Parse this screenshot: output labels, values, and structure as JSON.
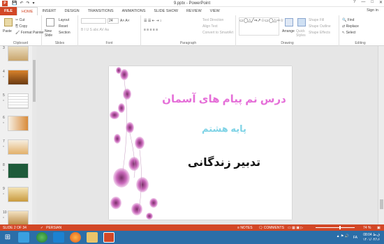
{
  "window": {
    "title": "9.pptx - PowerPoint",
    "app_icon": "P",
    "quick_access": [
      "save-icon",
      "undo-icon",
      "redo-icon",
      "customize-icon"
    ],
    "controls": [
      "?",
      "—",
      "□",
      "✕"
    ]
  },
  "tabs": [
    "FILE",
    "HOME",
    "INSERT",
    "DESIGN",
    "TRANSITIONS",
    "ANIMATIONS",
    "SLIDE SHOW",
    "REVIEW",
    "VIEW"
  ],
  "active_tab": "HOME",
  "signin": "Sign in",
  "ribbon": {
    "clipboard": {
      "label": "Clipboard",
      "paste": "Paste",
      "cut": "Cut",
      "copy": "Copy",
      "format_painter": "Format Painter"
    },
    "slides": {
      "label": "Slides",
      "new_slide": "New Slide",
      "layout": "Layout",
      "reset": "Reset",
      "section": "Section"
    },
    "font": {
      "label": "Font",
      "size": "24",
      "styles": "B  I  U  S  abc  AV  Aa",
      "grow_shrink": "A˄ A˅"
    },
    "paragraph": {
      "label": "Paragraph",
      "text_direction": "Text Direction",
      "align_text": "Align Text",
      "smartart": "Convert to SmartArt"
    },
    "drawing": {
      "label": "Drawing",
      "arrange": "Arrange",
      "quick_styles": "Quick Styles",
      "shape_fill": "Shape Fill",
      "shape_outline": "Shape Outline",
      "shape_effects": "Shape Effects"
    },
    "editing": {
      "label": "Editing",
      "find": "Find",
      "replace": "Replace",
      "select": "Select"
    }
  },
  "thumbnails": [
    {
      "num": "3",
      "star": ""
    },
    {
      "num": "4",
      "star": "*"
    },
    {
      "num": "5",
      "star": "*"
    },
    {
      "num": "6",
      "star": "*"
    },
    {
      "num": "7",
      "star": "*"
    },
    {
      "num": "8",
      "star": "*"
    },
    {
      "num": "9",
      "star": "*"
    },
    {
      "num": "10",
      "star": "*"
    }
  ],
  "slide": {
    "line1": "درس نم پیام های آسمان",
    "line2": "پایه هشتم",
    "line3": "تدبیر زندگانی"
  },
  "status": {
    "slide_of": "SLIDE 2 OF 34",
    "language": "PERSIAN",
    "notes": "NOTES",
    "comments": "COMMENTS",
    "zoom": "74 %"
  },
  "taskbar": {
    "time": "08:04 ق.ظ",
    "date": "۱۴۰۱/۰۴/۱۶",
    "lang": "FA"
  },
  "colors": {
    "accent": "#d24726",
    "taskbar": "#2b6ea8",
    "slide_title": "#e56fd8",
    "slide_subtitle": "#7fd3e6"
  }
}
